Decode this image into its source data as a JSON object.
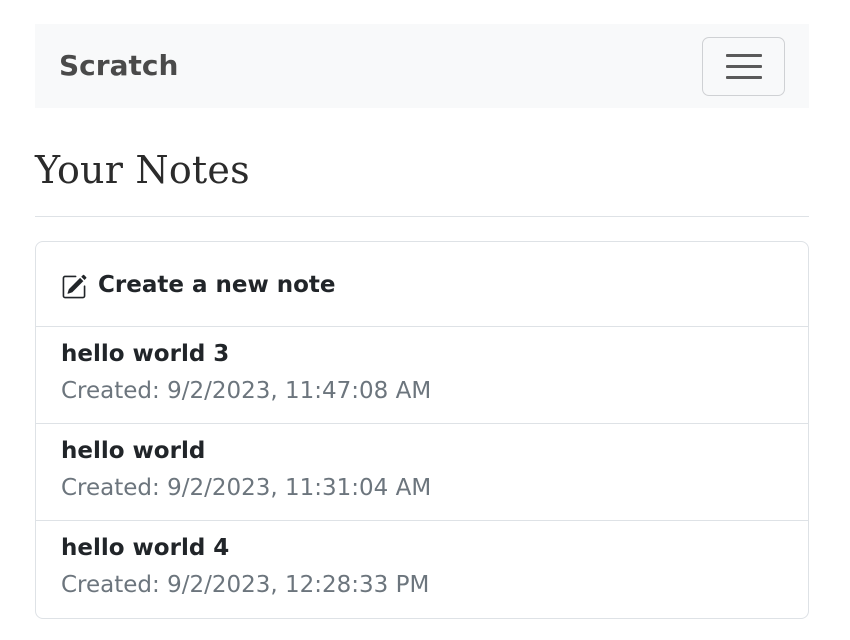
{
  "navbar": {
    "brand": "Scratch",
    "toggle_icon": "hamburger-menu-icon"
  },
  "page": {
    "title": "Your Notes"
  },
  "create_note": {
    "icon": "pencil-square-icon",
    "label": "Create a new note"
  },
  "notes": [
    {
      "title": "hello world 3",
      "created": "Created: 9/2/2023, 11:47:08 AM"
    },
    {
      "title": "hello world",
      "created": "Created: 9/2/2023, 11:31:04 AM"
    },
    {
      "title": "hello world 4",
      "created": "Created: 9/2/2023, 12:28:33 PM"
    }
  ],
  "colors": {
    "navbar_bg": "#f8f9fa",
    "brand_text": "#4a4a4a",
    "border": "#dee2e6",
    "muted_text": "#6c757d",
    "body_text": "#212529"
  }
}
